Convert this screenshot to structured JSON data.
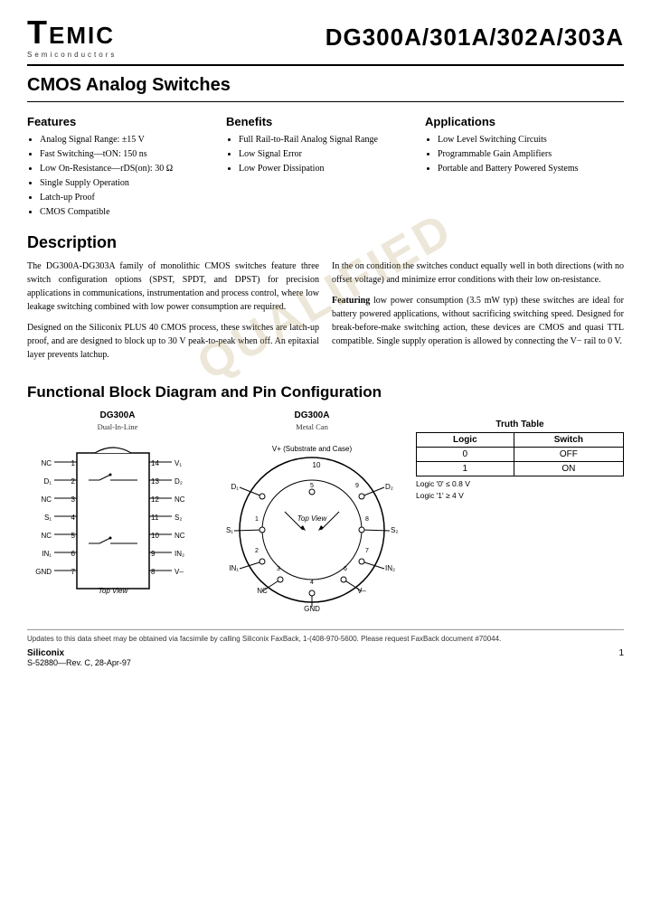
{
  "header": {
    "logo_t": "T",
    "logo_rest": "EMIC",
    "logo_sub": "Semiconductors",
    "part_number": "DG300A/301A/302A/303A"
  },
  "page_title": "CMOS Analog Switches",
  "features": {
    "title": "Features",
    "items": [
      "Analog Signal Range: ±15 V",
      "Fast Switching—tON: 150 ns",
      "Low On-Resistance—rDS(on): 30 Ω",
      "Single Supply Operation",
      "Latch-up Proof",
      "CMOS Compatible"
    ]
  },
  "benefits": {
    "title": "Benefits",
    "items": [
      "Full Rail-to-Rail Analog Signal Range",
      "Low Signal Error",
      "Low Power Dissipation"
    ]
  },
  "applications": {
    "title": "Applications",
    "items": [
      "Low Level Switching Circuits",
      "Programmable Gain Amplifiers",
      "Portable and Battery Powered Systems"
    ]
  },
  "description": {
    "title": "Description",
    "col1_p1": "The DG300A-DG303A family of monolithic CMOS switches feature three switch configuration options (SPST, SPDT, and DPST) for precision applications in communications, instrumentation and process control, where low leakage switching combined with low power consumption are required.",
    "col1_p2": "Designed on the Siliconix PLUS 40 CMOS process, these switches are latch-up proof, and are designed to block up to 30 V peak-to-peak when off. An epitaxial layer prevents latchup.",
    "col2_p1": "In the on condition the switches conduct equally well in both directions (with no offset voltage) and minimize error conditions with their low on-resistance.",
    "col2_p2_featuring": "Featuring",
    "col2_p2_rest": " low power consumption (3.5 mW typ) these switches are ideal for battery powered applications, without sacrificing switching speed. Designed for break-before-make switching action, these devices are CMOS and quasi TTL compatible. Single supply operation is allowed by connecting the V− rail to 0 V.",
    "watermark": "QUALIFIED"
  },
  "fbd": {
    "title": "Functional Block Diagram and Pin Configuration",
    "ic_label": "DG300A",
    "ic_package": "Dual-In-Line",
    "can_label": "DG300A",
    "can_package": "Metal Can",
    "truth_table": {
      "title": "Truth Table",
      "headers": [
        "Logic",
        "Switch"
      ],
      "rows": [
        [
          "0",
          "OFF"
        ],
        [
          "1",
          "ON"
        ]
      ],
      "notes": [
        "Logic '0' ≤ 0.8 V",
        "Logic '1' ≥ 4 V"
      ]
    }
  },
  "footer": {
    "note": "Updates to this data sheet may be obtained via facsimile by calling Siliconix FaxBack, 1-(408-970-5600. Please request FaxBack document #70044.",
    "company": "Siliconix",
    "revision": "S-52880—Rev. C, 28-Apr-97",
    "page": "1"
  }
}
